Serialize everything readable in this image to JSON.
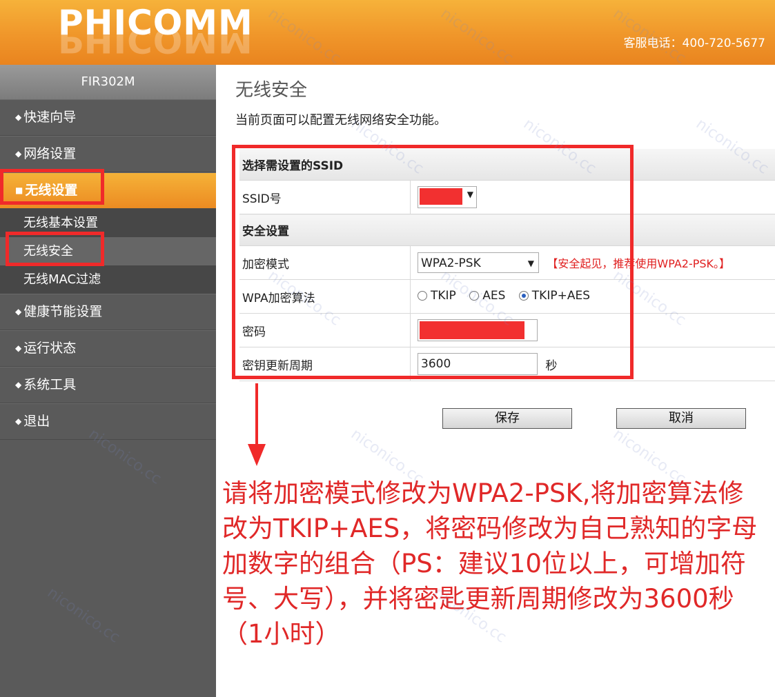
{
  "header": {
    "logo": "PHICOMM",
    "hotline": "客服电话：400-720-5677"
  },
  "sidebar": {
    "model": "FIR302M",
    "items": [
      {
        "label": "快速向导"
      },
      {
        "label": "网络设置"
      },
      {
        "label": "无线设置"
      },
      {
        "label": "健康节能设置"
      },
      {
        "label": "运行状态"
      },
      {
        "label": "系统工具"
      },
      {
        "label": "退出"
      }
    ],
    "sub_items": [
      {
        "label": "无线基本设置"
      },
      {
        "label": "无线安全"
      },
      {
        "label": "无线MAC过滤"
      }
    ]
  },
  "main": {
    "title": "无线安全",
    "description": "当前页面可以配置无线网络安全功能。",
    "section_ssid": "选择需设置的SSID",
    "ssid_label": "SSID号",
    "section_security": "安全设置",
    "encrypt_label": "加密模式",
    "encrypt_value": "WPA2-PSK",
    "encrypt_hint": "【安全起见，推荐使用WPA2-PSK。】",
    "algo_label": "WPA加密算法",
    "algo_options": [
      "TKIP",
      "AES",
      "TKIP+AES"
    ],
    "algo_selected": "TKIP+AES",
    "password_label": "密码",
    "renew_label": "密钥更新周期",
    "renew_value": "3600",
    "renew_unit": "秒",
    "save_button": "保存",
    "cancel_button": "取消"
  },
  "annotation": {
    "text": "请将加密模式修改为WPA2-PSK,将加密算法修改为TKIP+AES，将密码修改为自己熟知的字母加数字的组合（PS：建议10位以上，可增加符号、大写），并将密匙更新周期修改为3600秒（1小时）"
  },
  "watermark": {
    "text": "niconico.cc"
  },
  "colors": {
    "header_orange": "#f0962a",
    "sidebar_gray": "#5a5a5a",
    "highlight_red": "#f02a2a"
  }
}
